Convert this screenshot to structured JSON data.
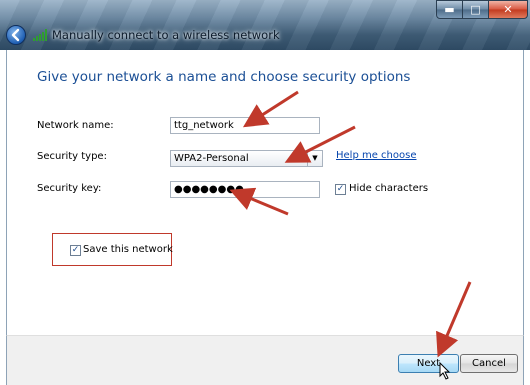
{
  "window": {
    "title": "Manually connect to a wireless network",
    "controls": [
      "minimize-icon",
      "maximize-icon",
      "close-icon"
    ]
  },
  "icons": {
    "back": "back-arrow-icon",
    "wireless": "wireless-signal-icon",
    "dropdown": "chevron-down-icon",
    "cursor": "mouse-pointer-icon"
  },
  "page": {
    "heading": "Give your network a name and choose security options"
  },
  "form": {
    "network_name": {
      "label": "Network name:",
      "value": "ttg_network"
    },
    "security_type": {
      "label": "Security type:",
      "value": "WPA2-Personal"
    },
    "help_link": "Help me choose",
    "security_key": {
      "label": "Security key:",
      "value": "●●●●●●●●"
    },
    "hide_characters": {
      "label": "Hide characters",
      "checked": true
    },
    "save_network": {
      "label": "Save this network",
      "checked": true
    }
  },
  "footer": {
    "next_label": "Next",
    "cancel_label": "Cancel"
  },
  "colors": {
    "heading": "#1b4f95",
    "annotation": "#c0392b",
    "link": "#0645ad"
  }
}
